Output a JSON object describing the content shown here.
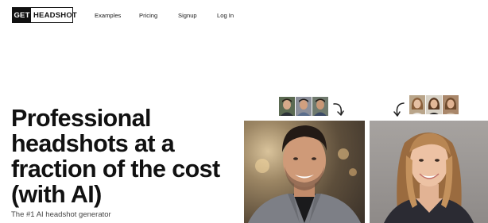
{
  "header": {
    "logo_get": "GET",
    "logo_word": "HEADSHOT",
    "nav": [
      {
        "label": "Examples"
      },
      {
        "label": "Pricing"
      },
      {
        "label": "Signup"
      },
      {
        "label": "Log In"
      }
    ]
  },
  "hero": {
    "title_lines": [
      "Professional",
      "headshots at a",
      "fraction of the cost",
      "(with AI)"
    ],
    "subtitle": "The #1 AI headshot generator"
  },
  "icons": {
    "arrow_right": "curved-arrow-down-icon",
    "arrow_left": "curved-arrow-down-icon"
  },
  "colors": {
    "text": "#111111",
    "subtitle": "#444444",
    "background": "#ffffff"
  }
}
